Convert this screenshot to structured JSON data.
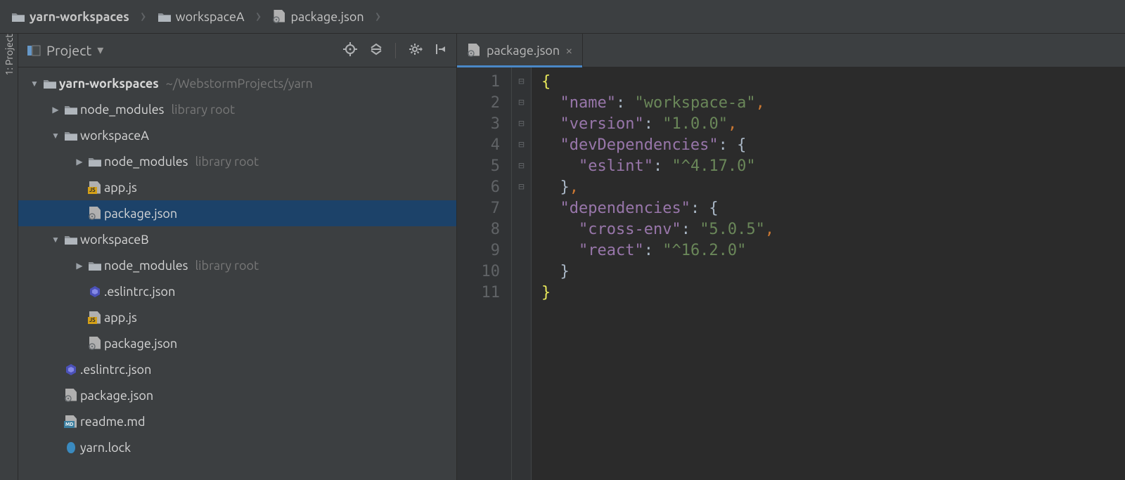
{
  "breadcrumbs": [
    {
      "icon": "folder",
      "label": "yarn-workspaces"
    },
    {
      "icon": "folder",
      "label": "workspaceA"
    },
    {
      "icon": "json",
      "label": "package.json"
    }
  ],
  "toolwindow_label": "1: Project",
  "sidebar_title": "Project",
  "tree": [
    {
      "indent": 0,
      "arrow": "down",
      "icon": "folder",
      "name": "yarn-workspaces",
      "bold": true,
      "hint": "~/WebstormProjects/yarn",
      "selected": false
    },
    {
      "indent": 1,
      "arrow": "right",
      "icon": "folder",
      "name": "node_modules",
      "bold": false,
      "hint": "library root",
      "selected": false
    },
    {
      "indent": 1,
      "arrow": "down",
      "icon": "folder",
      "name": "workspaceA",
      "bold": false,
      "hint": "",
      "selected": false
    },
    {
      "indent": 2,
      "arrow": "right",
      "icon": "folder",
      "name": "node_modules",
      "bold": false,
      "hint": "library root",
      "selected": false
    },
    {
      "indent": 2,
      "arrow": "",
      "icon": "js",
      "name": "app.js",
      "bold": false,
      "hint": "",
      "selected": false
    },
    {
      "indent": 2,
      "arrow": "",
      "icon": "json",
      "name": "package.json",
      "bold": false,
      "hint": "",
      "selected": true
    },
    {
      "indent": 1,
      "arrow": "down",
      "icon": "folder",
      "name": "workspaceB",
      "bold": false,
      "hint": "",
      "selected": false
    },
    {
      "indent": 2,
      "arrow": "right",
      "icon": "folder",
      "name": "node_modules",
      "bold": false,
      "hint": "library root",
      "selected": false
    },
    {
      "indent": 2,
      "arrow": "",
      "icon": "hex",
      "name": ".eslintrc.json",
      "bold": false,
      "hint": "",
      "selected": false
    },
    {
      "indent": 2,
      "arrow": "",
      "icon": "js",
      "name": "app.js",
      "bold": false,
      "hint": "",
      "selected": false
    },
    {
      "indent": 2,
      "arrow": "",
      "icon": "json",
      "name": "package.json",
      "bold": false,
      "hint": "",
      "selected": false
    },
    {
      "indent": 1,
      "arrow": "",
      "icon": "hex",
      "name": ".eslintrc.json",
      "bold": false,
      "hint": "",
      "selected": false
    },
    {
      "indent": 1,
      "arrow": "",
      "icon": "json",
      "name": "package.json",
      "bold": false,
      "hint": "",
      "selected": false
    },
    {
      "indent": 1,
      "arrow": "",
      "icon": "md",
      "name": "readme.md",
      "bold": false,
      "hint": "",
      "selected": false
    },
    {
      "indent": 1,
      "arrow": "",
      "icon": "yarn",
      "name": "yarn.lock",
      "bold": false,
      "hint": "",
      "selected": false
    }
  ],
  "tabs": [
    {
      "icon": "json",
      "label": "package.json",
      "active": true
    }
  ],
  "code_lines": 11,
  "code": {
    "l1": [
      {
        "t": "{",
        "c": "br"
      }
    ],
    "l2": [
      {
        "t": "  ",
        "c": "w"
      },
      {
        "t": "\"name\"",
        "c": "key"
      },
      {
        "t": ": ",
        "c": "w"
      },
      {
        "t": "\"workspace-a\"",
        "c": "str"
      },
      {
        "t": ",",
        "c": "p"
      }
    ],
    "l3": [
      {
        "t": "  ",
        "c": "w"
      },
      {
        "t": "\"version\"",
        "c": "key"
      },
      {
        "t": ": ",
        "c": "w"
      },
      {
        "t": "\"1.0.0\"",
        "c": "str"
      },
      {
        "t": ",",
        "c": "p"
      }
    ],
    "l4": [
      {
        "t": "  ",
        "c": "w"
      },
      {
        "t": "\"devDependencies\"",
        "c": "key"
      },
      {
        "t": ": {",
        "c": "w"
      }
    ],
    "l5": [
      {
        "t": "    ",
        "c": "w"
      },
      {
        "t": "\"eslint\"",
        "c": "key"
      },
      {
        "t": ": ",
        "c": "w"
      },
      {
        "t": "\"^4.17.0\"",
        "c": "str"
      }
    ],
    "l6": [
      {
        "t": "  }",
        "c": "w"
      },
      {
        "t": ",",
        "c": "p"
      }
    ],
    "l7": [
      {
        "t": "  ",
        "c": "w"
      },
      {
        "t": "\"dependencies\"",
        "c": "key"
      },
      {
        "t": ": {",
        "c": "w"
      }
    ],
    "l8": [
      {
        "t": "    ",
        "c": "w"
      },
      {
        "t": "\"cross-env\"",
        "c": "key"
      },
      {
        "t": ": ",
        "c": "w"
      },
      {
        "t": "\"5.0.5\"",
        "c": "str"
      },
      {
        "t": ",",
        "c": "p"
      }
    ],
    "l9": [
      {
        "t": "    ",
        "c": "w"
      },
      {
        "t": "\"react\"",
        "c": "key"
      },
      {
        "t": ": ",
        "c": "w"
      },
      {
        "t": "\"^16.2.0\"",
        "c": "str"
      }
    ],
    "l10": [
      {
        "t": "  }",
        "c": "w"
      }
    ],
    "l11": [
      {
        "t": "}",
        "c": "br"
      }
    ]
  },
  "fold": {
    "1": "down",
    "4": "down",
    "6": "up",
    "7": "down",
    "10": "up",
    "11": "up"
  }
}
